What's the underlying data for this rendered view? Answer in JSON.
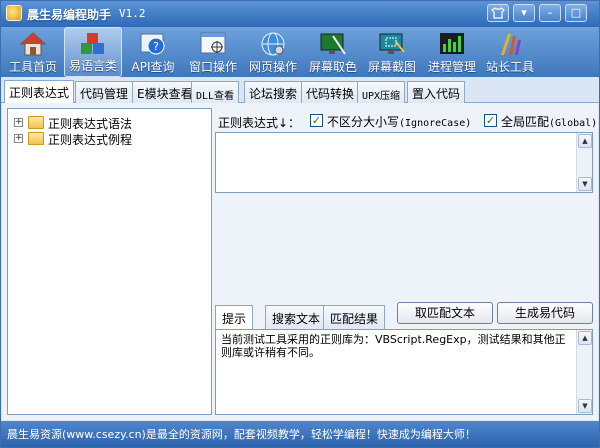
{
  "app": {
    "title": "晨生易编程助手",
    "version": "V1.2"
  },
  "toolbar": {
    "items": [
      {
        "label": "工具首页",
        "icon": "house-icon"
      },
      {
        "label": "易语言类",
        "icon": "blocks-icon"
      },
      {
        "label": "API查询",
        "icon": "help-window-icon"
      },
      {
        "label": "窗口操作",
        "icon": "window-target-icon"
      },
      {
        "label": "网页操作",
        "icon": "globe-icon"
      },
      {
        "label": "屏幕取色",
        "icon": "color-picker-icon"
      },
      {
        "label": "屏幕截图",
        "icon": "screenshot-icon"
      },
      {
        "label": "进程管理",
        "icon": "process-chart-icon"
      },
      {
        "label": "站长工具",
        "icon": "webmaster-tools-icon"
      }
    ],
    "active_index": 1
  },
  "main_tabs": {
    "items": [
      "正则表达式",
      "代码管理",
      "E模块查看",
      "DLL查看",
      "论坛搜索",
      "代码转换",
      "UPX压缩",
      "置入代码"
    ],
    "active_index": 0
  },
  "tree": {
    "items": [
      "正则表达式语法",
      "正则表达式例程"
    ]
  },
  "regex": {
    "label": "正则表达式↓：",
    "ignore_case_label": "不区分大小写",
    "ignore_case_hint": "(IgnoreCase)",
    "ignore_case_checked": true,
    "global_label": "全局匹配",
    "global_hint": "(Global)",
    "global_checked": true,
    "value": ""
  },
  "sub_tabs": {
    "items": [
      "提示",
      "搜索文本",
      "匹配结果"
    ],
    "active_index": 0
  },
  "buttons": {
    "get_match": "取匹配文本",
    "gen_code": "生成易代码"
  },
  "result": {
    "text": "当前测试工具采用的正则库为：VBScript.RegExp，测试结果和其他正则库或许稍有不同。"
  },
  "status": {
    "text": "晨生易资源(www.csezy.cn)是最全的资源网，配套视频教学，轻松学编程！快速成为编程大师！"
  }
}
